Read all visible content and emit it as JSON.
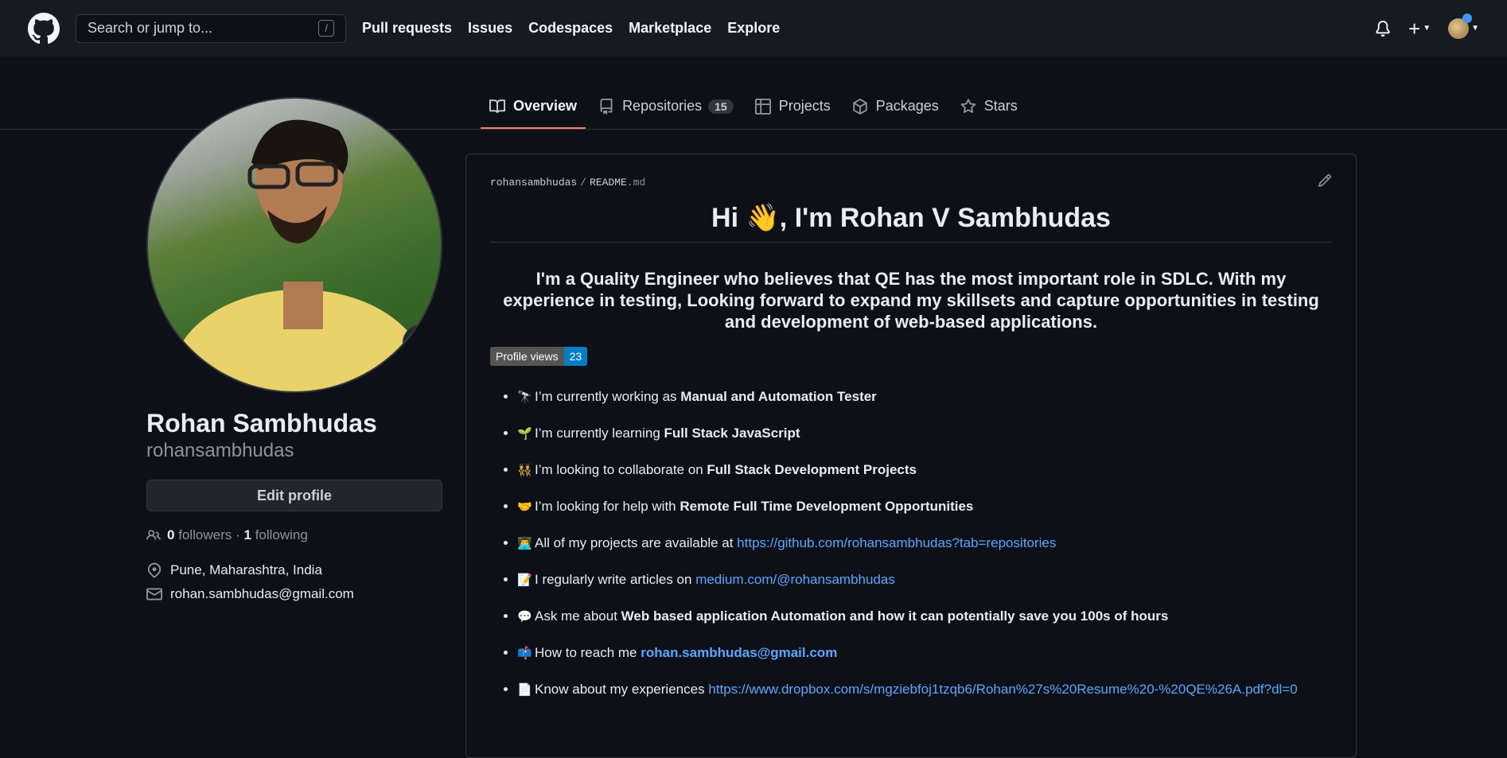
{
  "header": {
    "search_placeholder": "Search or jump to...",
    "search_shortcut": "/",
    "nav": [
      "Pull requests",
      "Issues",
      "Codespaces",
      "Marketplace",
      "Explore"
    ]
  },
  "tabs": {
    "overview": "Overview",
    "repositories": "Repositories",
    "repositories_count": "15",
    "projects": "Projects",
    "packages": "Packages",
    "stars": "Stars"
  },
  "profile": {
    "name": "Rohan Sambhudas",
    "login": "rohansambhudas",
    "edit_label": "Edit profile",
    "followers_count": "0",
    "followers_label": "followers",
    "dot": "·",
    "following_count": "1",
    "following_label": "following",
    "location": "Pune, Maharashtra, India",
    "email": "rohan.sambhudas@gmail.com"
  },
  "readme": {
    "owner": "rohansambhudas",
    "sep": "/",
    "file": "README",
    "ext": ".md",
    "heading": "Hi 👋, I'm Rohan V Sambhudas",
    "bio": "I'm a Quality Engineer who believes that QE has the most important role in SDLC. With my experience in testing, Looking forward to expand my skillsets and capture opportunities in testing and development of web-based applications.",
    "badge_label": "Profile views",
    "badge_value": "23",
    "items": [
      {
        "emoji": "🔭",
        "text": "I’m currently working as ",
        "strong": "Manual and Automation Tester"
      },
      {
        "emoji": "🌱",
        "text": "I’m currently learning ",
        "strong": "Full Stack JavaScript"
      },
      {
        "emoji": "👯",
        "text": "I’m looking to collaborate on ",
        "strong": "Full Stack Development Projects"
      },
      {
        "emoji": "🤝",
        "text": "I’m looking for help with ",
        "strong": "Remote Full Time Development Opportunities"
      },
      {
        "emoji": "👨‍💻",
        "text": "All of my projects are available at ",
        "link": "https://github.com/rohansambhudas?tab=repositories"
      },
      {
        "emoji": "📝",
        "text": "I regularly write articles on ",
        "link": "medium.com/@rohansambhudas"
      },
      {
        "emoji": "💬",
        "text": "Ask me about ",
        "strong": "Web based application Automation and how it can potentially save you 100s of hours"
      },
      {
        "emoji": "📫",
        "text": "How to reach me ",
        "link_strong": "rohan.sambhudas@gmail.com"
      },
      {
        "emoji": "📄",
        "text": "Know about my experiences ",
        "link": "https://www.dropbox.com/s/mgziebfoj1tzqb6/Rohan%27s%20Resume%20-%20QE%26A.pdf?dl=0"
      }
    ]
  },
  "colors": {
    "background": "#0d1117",
    "header_bg": "#161b22",
    "link": "#58a6ff",
    "tab_active_underline": "#f78166",
    "badge_value_bg": "#007ec6"
  }
}
